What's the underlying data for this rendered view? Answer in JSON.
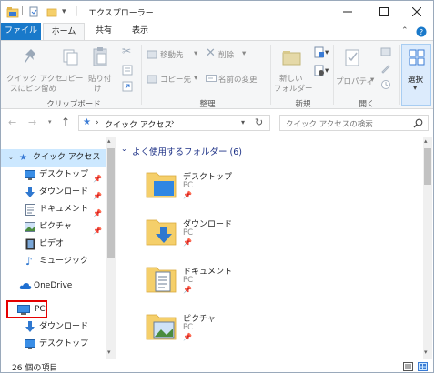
{
  "window": {
    "title": "エクスプローラー"
  },
  "tabs": {
    "file": "ファイル",
    "home": "ホーム",
    "share": "共有",
    "view": "表示"
  },
  "ribbon": {
    "pin_label_1": "クイック アクセ",
    "pin_label_2": "スにピン留め",
    "copy": "コピー",
    "paste_1": "貼り付",
    "paste_2": "け",
    "clipboard_group": "クリップボード",
    "move_to": "移動先",
    "copy_to": "コピー先",
    "delete": "削除",
    "rename": "名前の変更",
    "organize_group": "整理",
    "new_folder_1": "新しい",
    "new_folder_2": "フォルダー",
    "new_group": "新規",
    "properties": "プロパティ",
    "open_group": "開く",
    "select": "選択"
  },
  "address": {
    "path": "クイック アクセス",
    "sep": "›"
  },
  "search": {
    "placeholder": "クイック アクセスの検索"
  },
  "nav": {
    "items": [
      {
        "label": "クイック アクセス"
      },
      {
        "label": "デスクトップ"
      },
      {
        "label": "ダウンロード"
      },
      {
        "label": "ドキュメント"
      },
      {
        "label": "ピクチャ"
      },
      {
        "label": "ビデオ"
      },
      {
        "label": "ミュージック"
      },
      {
        "label": "OneDrive"
      },
      {
        "label": "PC"
      },
      {
        "label": "ダウンロード"
      },
      {
        "label": "デスクトップ"
      }
    ]
  },
  "main": {
    "section": "よく使用するフォルダー (6)",
    "folders": [
      {
        "name": "デスクトップ",
        "location": "PC"
      },
      {
        "name": "ダウンロード",
        "location": "PC"
      },
      {
        "name": "ドキュメント",
        "location": "PC"
      },
      {
        "name": "ピクチャ",
        "location": "PC"
      }
    ]
  },
  "status": {
    "count": "26 個の項目"
  },
  "colors": {
    "accent": "#1979ca",
    "selection": "#cce8ff",
    "highlight_box": "#e60000",
    "folder": "#f5cf6a"
  }
}
